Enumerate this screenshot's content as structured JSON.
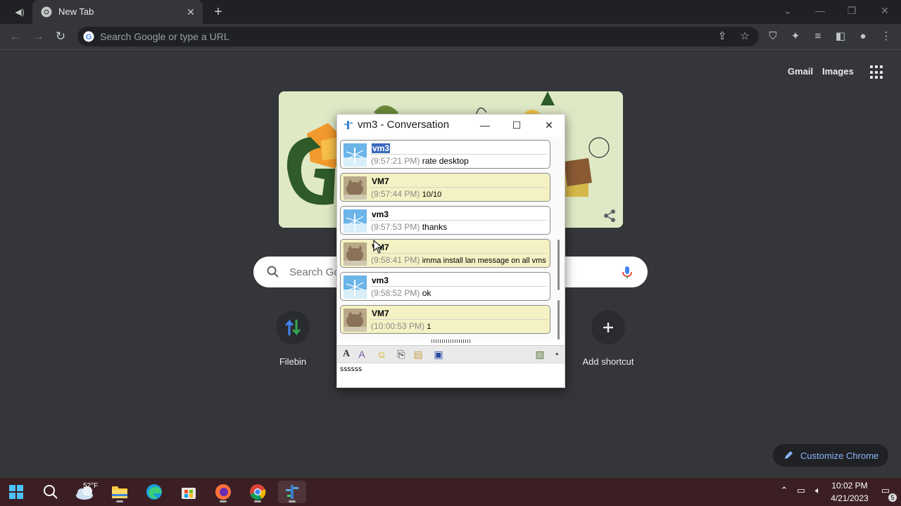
{
  "tab": {
    "title": "New Tab"
  },
  "omnibox": {
    "placeholder": "Search Google or type a URL"
  },
  "ntp": {
    "gmail": "Gmail",
    "images": "Images",
    "search_placeholder": "Search Go",
    "shortcuts": [
      {
        "label": "Filebin",
        "icon": "up-down-arrows-icon"
      },
      {
        "label": "Add shortcut",
        "icon": "plus-icon"
      }
    ],
    "customize": "Customize Chrome"
  },
  "conversation": {
    "title": "vm3 - Conversation",
    "messages": [
      {
        "name": "vm3",
        "time": "(9:57:21 PM)",
        "text": "rate desktop"
      },
      {
        "name": "VM7",
        "time": "(9:57:44 PM)",
        "text": "10/10"
      },
      {
        "name": "vm3",
        "time": "(9:57:53 PM)",
        "text": "thanks"
      },
      {
        "name": "VM7",
        "time": "(9:58:41 PM)",
        "text": "imma install lan message on all vms"
      },
      {
        "name": "vm3",
        "time": "(9:58:52 PM)",
        "text": "ok"
      },
      {
        "name": "VM7",
        "time": "(10:00:53 PM)",
        "text": "1"
      }
    ],
    "input_value": "ssssss"
  },
  "taskbar": {
    "weather": "52°F",
    "time": "10:02 PM",
    "date": "4/21/2023",
    "notifications": "5"
  },
  "colors": {
    "chrome_bg": "#35363a",
    "tabstrip": "#202124",
    "vm7_bubble": "#f4f2c4",
    "taskbar": "#3b1f24",
    "accent_link": "#8ab4f8"
  }
}
